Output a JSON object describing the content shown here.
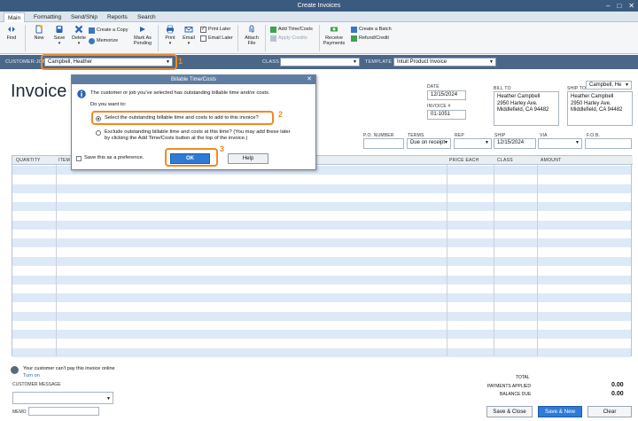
{
  "window": {
    "title": "Create Invoices"
  },
  "tabs": [
    "Main",
    "Formatting",
    "Send/Ship",
    "Reports",
    "Search"
  ],
  "ribbon": {
    "find": "Find",
    "new": "New",
    "save": "Save",
    "delete": "Delete",
    "create_copy": "Create a Copy",
    "memorize": "Memorize",
    "mark_as": "Mark As",
    "pending": "Pending",
    "print": "Print",
    "email": "Email",
    "print_later": "Print Later",
    "email_later": "Email Later",
    "attach": "Attach",
    "file": "File",
    "add_time_costs": "Add Time/Costs",
    "apply_credits": "Apply Credits",
    "receive": "Receive",
    "payments": "Payments",
    "create_batch": "Create a Batch",
    "refund_credit": "Refund/Credit"
  },
  "customer_bar": {
    "customer_job_label": "CUSTOMER:JOB",
    "customer_job_value": "Campbell, Heather",
    "class_label": "CLASS",
    "template_label": "TEMPLATE",
    "template_value": "Intuit Product Invoice"
  },
  "annotations": [
    "1",
    "2",
    "3"
  ],
  "invoice": {
    "title": "Invoice",
    "date_label": "DATE",
    "date_value": "12/15/2024",
    "invoice_no_label": "INVOICE #",
    "invoice_no_value": "01-1051",
    "bill_to_label": "BILL TO",
    "bill_to_lines": [
      "Heather Campbell",
      "2950 Harley Ave.",
      "Middlefield, CA 94482"
    ],
    "ship_to_label": "SHIP TO",
    "ship_to_select": "Campbell, He",
    "ship_to_lines": [
      "Heather Campbell",
      "2950 Harley Ave.",
      "Middlefield, CA 94482"
    ],
    "po_label": "P.O. NUMBER",
    "terms_label": "TERMS",
    "terms_value": "Due on receipt",
    "rep_label": "REP",
    "ship_label": "SHIP",
    "ship_value": "12/15/2024",
    "via_label": "VIA",
    "fob_label": "F.O.B."
  },
  "grid_headers": [
    "QUANTITY",
    "ITEM",
    "PRICE EACH",
    "CLASS",
    "AMOUNT"
  ],
  "dialog": {
    "title": "Billable Time/Costs",
    "message": "The customer or job you've selected has outstanding billable time and/or costs.",
    "question": "Do you want to:",
    "option1": "Select the outstanding billable time and costs to add to this invoice?",
    "option2_line1": "Exclude outstanding billable time and costs at this time? (You may add these later",
    "option2_line2": "by clicking the Add Time/Costs button at the top of the invoice.)",
    "preference": "Save this as a preference.",
    "ok": "OK",
    "help": "Help"
  },
  "footer": {
    "online_pay": "Your customer can't pay this invoice online",
    "turn_on": "Turn on",
    "customer_message_label": "CUSTOMER MESSAGE",
    "memo_label": "MEMO",
    "total_label": "TOTAL",
    "payments_applied_label": "PAYMENTS APPLIED",
    "payments_applied_value": "0.00",
    "balance_due_label": "BALANCE DUE",
    "balance_due_value": "0.00",
    "save_close": "Save & Close",
    "save_new": "Save & New",
    "clear": "Clear"
  },
  "colors": {
    "accent": "#2e7bd6",
    "annotation": "#f08a24",
    "title_bar": "#3b5a80"
  }
}
